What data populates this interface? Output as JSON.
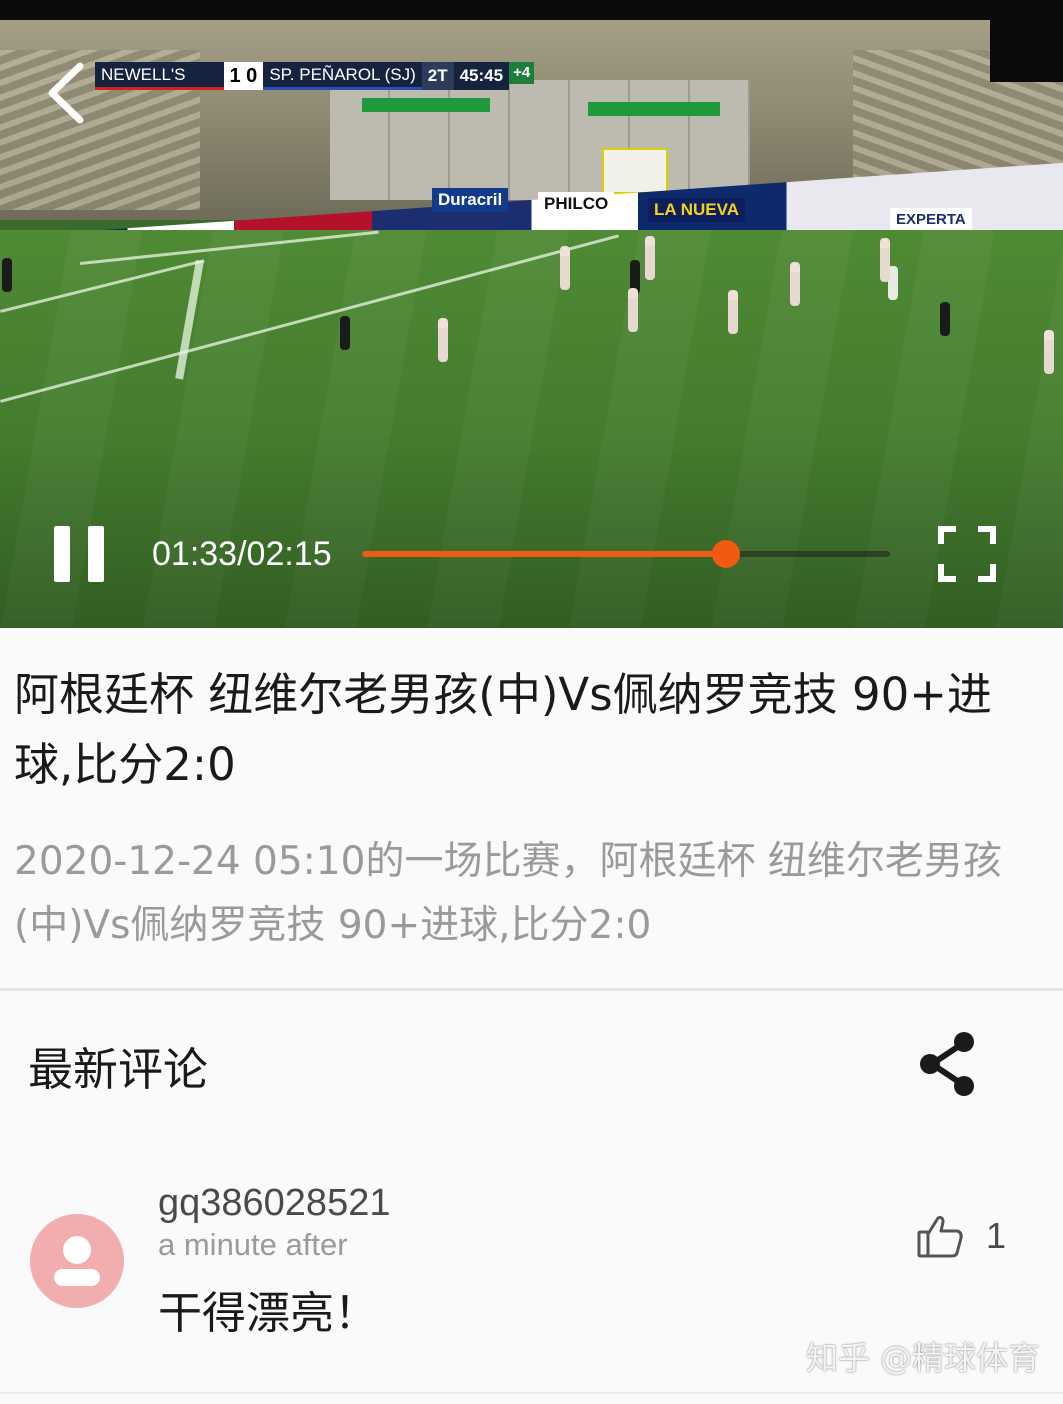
{
  "video": {
    "scoreboard": {
      "home": "NEWELL'S",
      "score": "1 0",
      "away": "SP. PEÑAROL (SJ)",
      "half": "2T",
      "clock": "45:45",
      "added": "+4"
    },
    "ads": [
      "Duracril",
      "PHILCO",
      "LA NUEVA",
      "EXPERTA"
    ],
    "time_display": "01:33/02:15",
    "progress_fraction": 0.69,
    "accent_color": "#f05a12"
  },
  "article": {
    "title": "阿根廷杯 纽维尔老男孩(中)Vs佩纳罗竞技 90+进球,比分2:0",
    "description": "2020-12-24 05:10的一场比赛，阿根廷杯 纽维尔老男孩(中)Vs佩纳罗竞技 90+进球,比分2:0"
  },
  "comments_section": {
    "title": "最新评论",
    "share_icon": "share-icon",
    "comments": [
      {
        "username": "gq386028521",
        "time": "a minute after",
        "text": "干得漂亮！",
        "likes": "1",
        "avatar_color": "#f2aeae"
      }
    ]
  },
  "watermark": "知乎 @精球体育"
}
